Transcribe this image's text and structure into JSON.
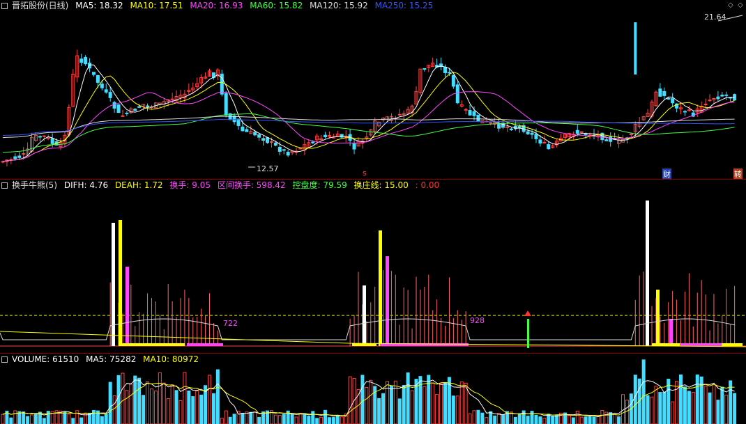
{
  "panel1": {
    "name": "晋拓股份(日线)",
    "ma": [
      {
        "label": "MA5: 18.32",
        "color": "#ffffff"
      },
      {
        "label": "MA10: 17.51",
        "color": "#ffff00"
      },
      {
        "label": "MA20: 16.93",
        "color": "#ff44ff"
      },
      {
        "label": "MA60: 15.82",
        "color": "#44ff44"
      },
      {
        "label": "MA120: 15.92",
        "color": "#dddddd"
      },
      {
        "label": "MA250: 15.25",
        "color": "#3355ff"
      }
    ],
    "high_label": "21.64",
    "low_label": "12.57",
    "marker_s": "s",
    "marker_cai": "财",
    "marker_zhuan": "转"
  },
  "panel2": {
    "name": "换手牛熊(5)",
    "items": [
      {
        "label": "DIFH: 4.76",
        "color": "#ffffff"
      },
      {
        "label": "DEAH: 1.72",
        "color": "#ffff00"
      },
      {
        "label": "换手: 9.05",
        "color": "#ff44ff"
      },
      {
        "label": "区间换手: 598.42",
        "color": "#ff44ff"
      },
      {
        "label": "控盘度: 79.59",
        "color": "#44ff44"
      },
      {
        "label": "换庄线: 15.00",
        "color": "#ffff00"
      },
      {
        "label": ": 0.00",
        "color": "#ff3333"
      }
    ],
    "label_a": "722",
    "label_b": "928"
  },
  "panel3": {
    "items": [
      {
        "label": "VOLUME: 61510",
        "color": "#ffffff"
      },
      {
        "label": "MA5: 75282",
        "color": "#ffffff"
      },
      {
        "label": "MA10: 80972",
        "color": "#ffff00"
      }
    ]
  },
  "controls": {
    "nav_left": "◇",
    "nav_right": "◇"
  },
  "colors": {
    "up": "#ff4444",
    "down": "#44ddff",
    "bg": "#000000",
    "grid": "#8b0000"
  }
}
